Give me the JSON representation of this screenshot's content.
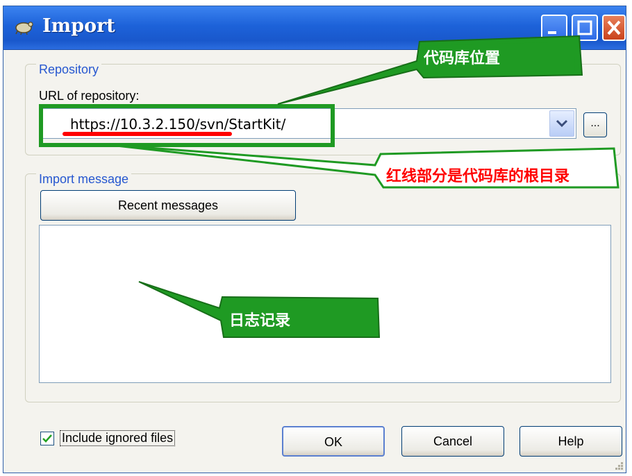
{
  "window": {
    "title": "Import",
    "accent_color": "#1d62d9"
  },
  "repository": {
    "legend": "Repository",
    "url_label": "URL of repository:",
    "url_value": "https://10.3.2.150/svn/StartKit/",
    "browse_label": "..."
  },
  "message": {
    "legend": "Import message",
    "recent_button": "Recent messages",
    "text": ""
  },
  "footer": {
    "include_ignored_label": "Include ignored files",
    "include_ignored_checked": true,
    "ok_label": "OK",
    "cancel_label": "Cancel",
    "help_label": "Help"
  },
  "annotations": {
    "repo_location": "代码库位置",
    "repo_root": "红线部分是代码库的根目录",
    "log_record": "日志记录",
    "annotation_color": "#1f9a23",
    "underline_color": "#ff0000"
  }
}
